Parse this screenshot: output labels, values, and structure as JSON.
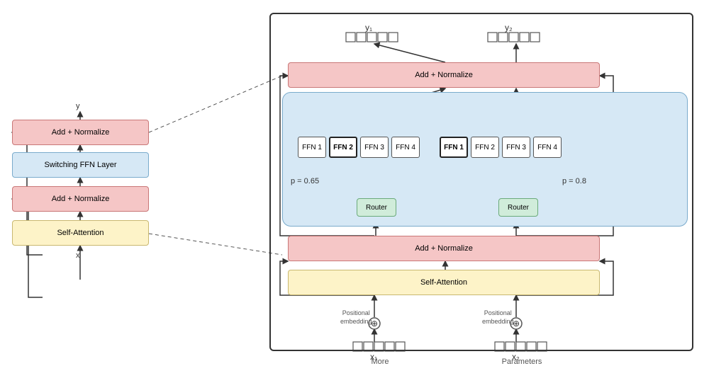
{
  "left_diagram": {
    "boxes": [
      {
        "id": "left-add-norm-top",
        "label": "Add + Normalize",
        "type": "red"
      },
      {
        "id": "left-switching",
        "label": "Switching FFN Layer",
        "type": "blue"
      },
      {
        "id": "left-add-norm-mid",
        "label": "Add + Normalize",
        "type": "red"
      },
      {
        "id": "left-self-attn",
        "label": "Self-Attention",
        "type": "yellow"
      }
    ],
    "x_label": "x",
    "y_label": "y"
  },
  "right_diagram": {
    "top_add_norm": "Add + Normalize",
    "bot_add_norm": "Add + Normalize",
    "self_attn": "Self-Attention",
    "switching_panel_label": "Switching FFN Layer",
    "ffn_groups": [
      {
        "id": "left",
        "ffns": [
          "FFN 1",
          "FFN 2",
          "FFN 3",
          "FFN 4"
        ],
        "bold_index": 1,
        "p_label": "p = 0.65",
        "router_label": "Router"
      },
      {
        "id": "right",
        "ffns": [
          "FFN 1",
          "FFN 2",
          "FFN 3",
          "FFN 4"
        ],
        "bold_index": 0,
        "p_label": "p = 0.8",
        "router_label": "Router"
      }
    ],
    "y_labels": [
      "y₁",
      "y₂"
    ],
    "x_labels": [
      "x₁",
      "x₂"
    ],
    "pos_emb_label": "Positional\nembedding",
    "more_label": "More",
    "params_label": "Parameters"
  }
}
